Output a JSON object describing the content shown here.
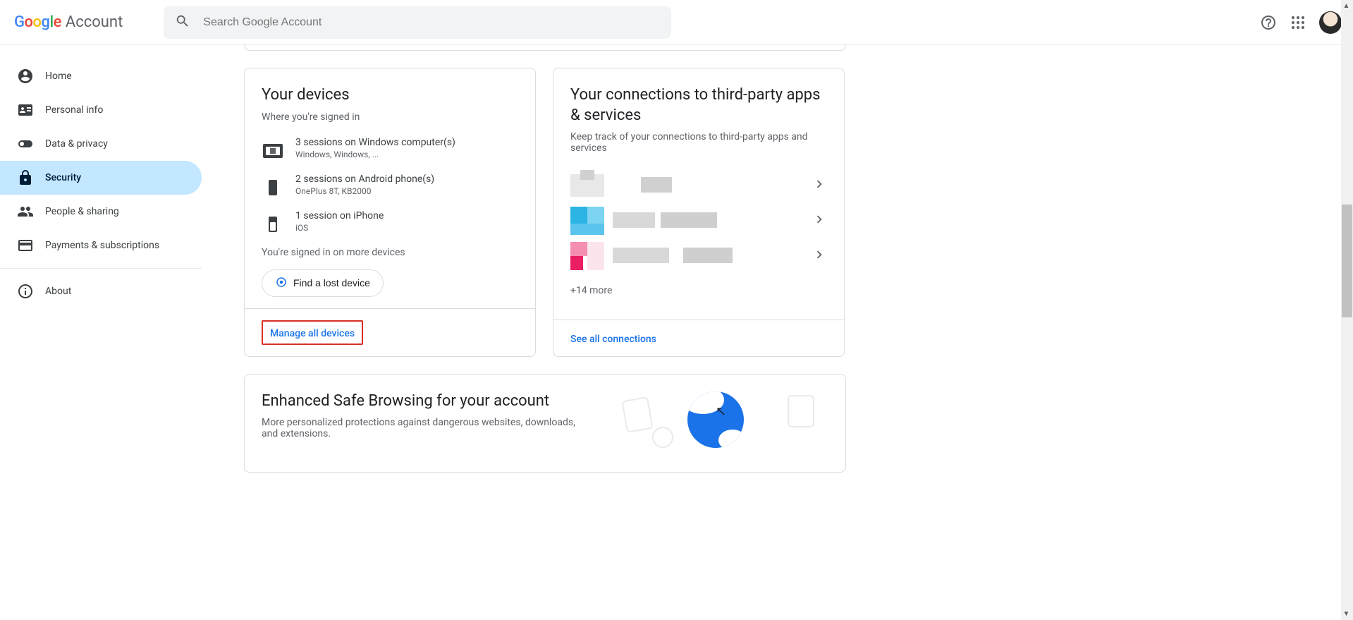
{
  "header": {
    "account_label": "Account",
    "search_placeholder": "Search Google Account"
  },
  "sidebar": {
    "items": [
      {
        "label": "Home"
      },
      {
        "label": "Personal info"
      },
      {
        "label": "Data & privacy"
      },
      {
        "label": "Security"
      },
      {
        "label": "People & sharing"
      },
      {
        "label": "Payments & subscriptions"
      },
      {
        "label": "About"
      }
    ]
  },
  "devices_card": {
    "title": "Your devices",
    "subtitle": "Where you're signed in",
    "rows": [
      {
        "title": "3 sessions on Windows computer(s)",
        "sub": "Windows, Windows, ..."
      },
      {
        "title": "2 sessions on Android phone(s)",
        "sub": "OnePlus 8T, KB2000"
      },
      {
        "title": "1 session on iPhone",
        "sub": "iOS"
      }
    ],
    "more_text": "You're signed in on more devices",
    "find_device": "Find a lost device",
    "manage_all": "Manage all devices"
  },
  "connections_card": {
    "title": "Your connections to third-party apps & services",
    "subtitle": "Keep track of your connections to third-party apps and services",
    "more_count": "+14 more",
    "see_all": "See all connections"
  },
  "safe_browsing": {
    "title": "Enhanced Safe Browsing for your account",
    "subtitle": "More personalized protections against dangerous websites, downloads, and extensions."
  }
}
